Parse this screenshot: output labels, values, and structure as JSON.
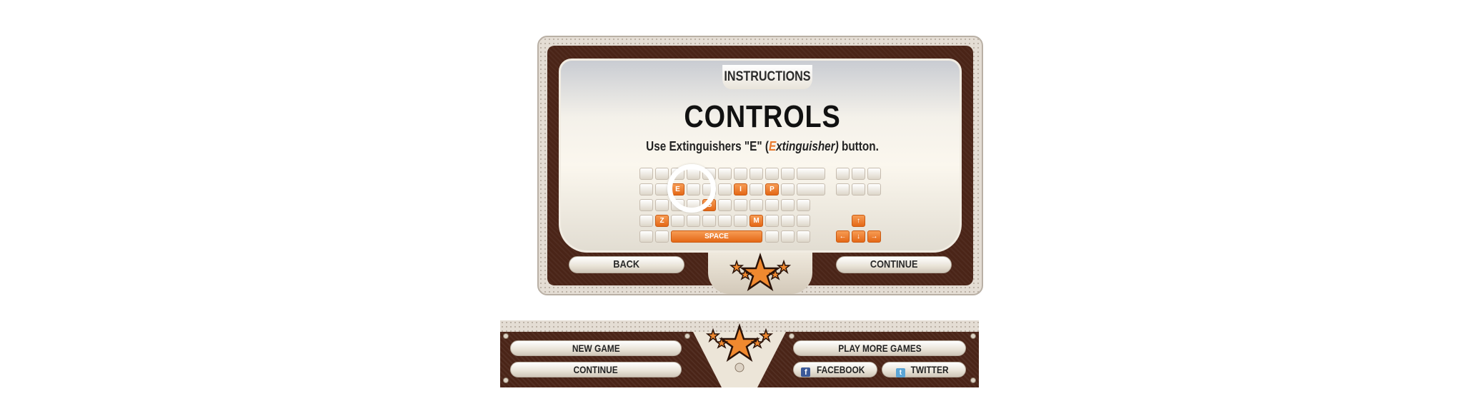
{
  "panel": {
    "tab_label": "INSTRUCTIONS",
    "title": "CONTROLS",
    "instruction": {
      "prefix": "Use Extinguishers \"E\" (",
      "highlight": "E",
      "italic_rest": "xtinguisher)",
      "suffix": " button."
    },
    "back_label": "BACK",
    "continue_label": "CONTINUE"
  },
  "keyboard": {
    "highlighted_keys": [
      "E",
      "I",
      "P",
      "G",
      "Z",
      "M"
    ],
    "space_label": "SPACE",
    "arrow_keys": {
      "up": "↑",
      "left": "←",
      "down": "↓",
      "right": "→"
    },
    "accent_color": "#e46817"
  },
  "menu_bar": {
    "new_game_label": "NEW GAME",
    "continue_label": "CONTINUE",
    "play_more_label": "PLAY MORE GAMES",
    "facebook_label": "FACEBOOK",
    "twitter_label": "TWITTER"
  },
  "colors": {
    "frame_brown": "#4a2417",
    "star_orange": "#f0892f",
    "panel_cream": "#f4f1ea"
  }
}
